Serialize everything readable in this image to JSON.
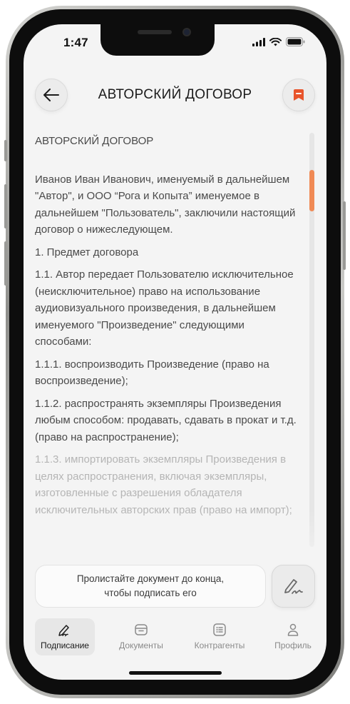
{
  "status_bar": {
    "time": "1:47"
  },
  "header": {
    "title": "АВТОРСКИЙ ДОГОВОР"
  },
  "document": {
    "heading": "АВТОРСКИЙ ДОГОВОР",
    "paragraphs": [
      "Иванов Иван Иванович, именуемый в дальнейшем \"Автор\", и ООО “Рога и Копыта” именуемое в дальнейшем \"Пользователь\", заключили настоящий договор о нижеследующем.",
      "1. Предмет договора",
      "1.1. Автор передает Пользователю исключительное (неисключительное) право на использование аудиовизуального произведения, в дальнейшем именуемого \"Произведение\" следующими способами:",
      "1.1.1. воспроизводить Произведение (право на воспроизведение);",
      "1.1.2. распространять экземпляры Произведения любым способом: продавать, сдавать в прокат и т.д. (право на распространение);",
      "1.1.3. импортировать экземпляры Произведения в целях распространения, включая экземпляры, изготовленные с разрешения обладателя исключительных авторских прав (право на импорт);"
    ],
    "scroll_progress": 0.1
  },
  "sign_hint": {
    "line1": "Пролистайте документ до конца,",
    "line2": "чтобы подписать его"
  },
  "tabs": [
    {
      "label": "Подписание",
      "icon": "pen-icon",
      "active": true
    },
    {
      "label": "Документы",
      "icon": "folder-icon",
      "active": false
    },
    {
      "label": "Контрагенты",
      "icon": "list-icon",
      "active": false
    },
    {
      "label": "Профиль",
      "icon": "person-icon",
      "active": false
    }
  ],
  "colors": {
    "accent": "#f08a55",
    "bookmark": "#e8542b",
    "background": "#f4f4f4"
  }
}
